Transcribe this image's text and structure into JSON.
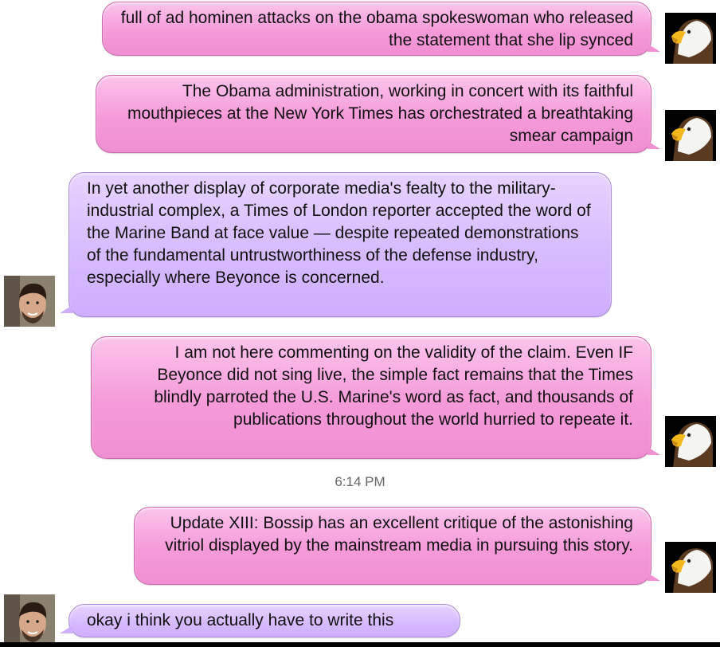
{
  "conversation": {
    "messages": [
      {
        "sender": "eagle",
        "text": "full of ad hominen attacks on the obama spokeswoman who released the statement that she lip synced"
      },
      {
        "sender": "eagle",
        "text": "The Obama administration, working in concert with its faithful mouthpieces at the New York Times has orchestrated a breathtaking smear campaign"
      },
      {
        "sender": "person",
        "text": "In yet another display of corporate media's fealty to the military-industrial complex, a Times of London reporter accepted the word of the Marine Band at face value — despite repeated demonstrations of the fundamental untrustworthiness of the defense industry, especially where Beyonce is concerned."
      },
      {
        "sender": "eagle",
        "text": "I am not here commenting on the validity of the claim. Even IF Beyonce did not sing live, the simple fact remains that the Times blindly parroted the U.S. Marine's word as fact, and thousands of publications throughout the world hurried to repeate it."
      },
      {
        "sender": "eagle",
        "text": "Update XIII: Bossip has an excellent critique of the astonishing vitriol displayed by the mainstream media in pursuing this story."
      },
      {
        "sender": "person",
        "text": "okay i think you actually have to write this"
      }
    ],
    "timestamp": "6:14 PM"
  },
  "colors": {
    "outgoing_bubble": "#f59ad8",
    "incoming_bubble": "#d7bbff"
  },
  "icons": {
    "eagle_avatar": "bald-eagle-icon",
    "person_avatar": "person-photo-icon"
  }
}
